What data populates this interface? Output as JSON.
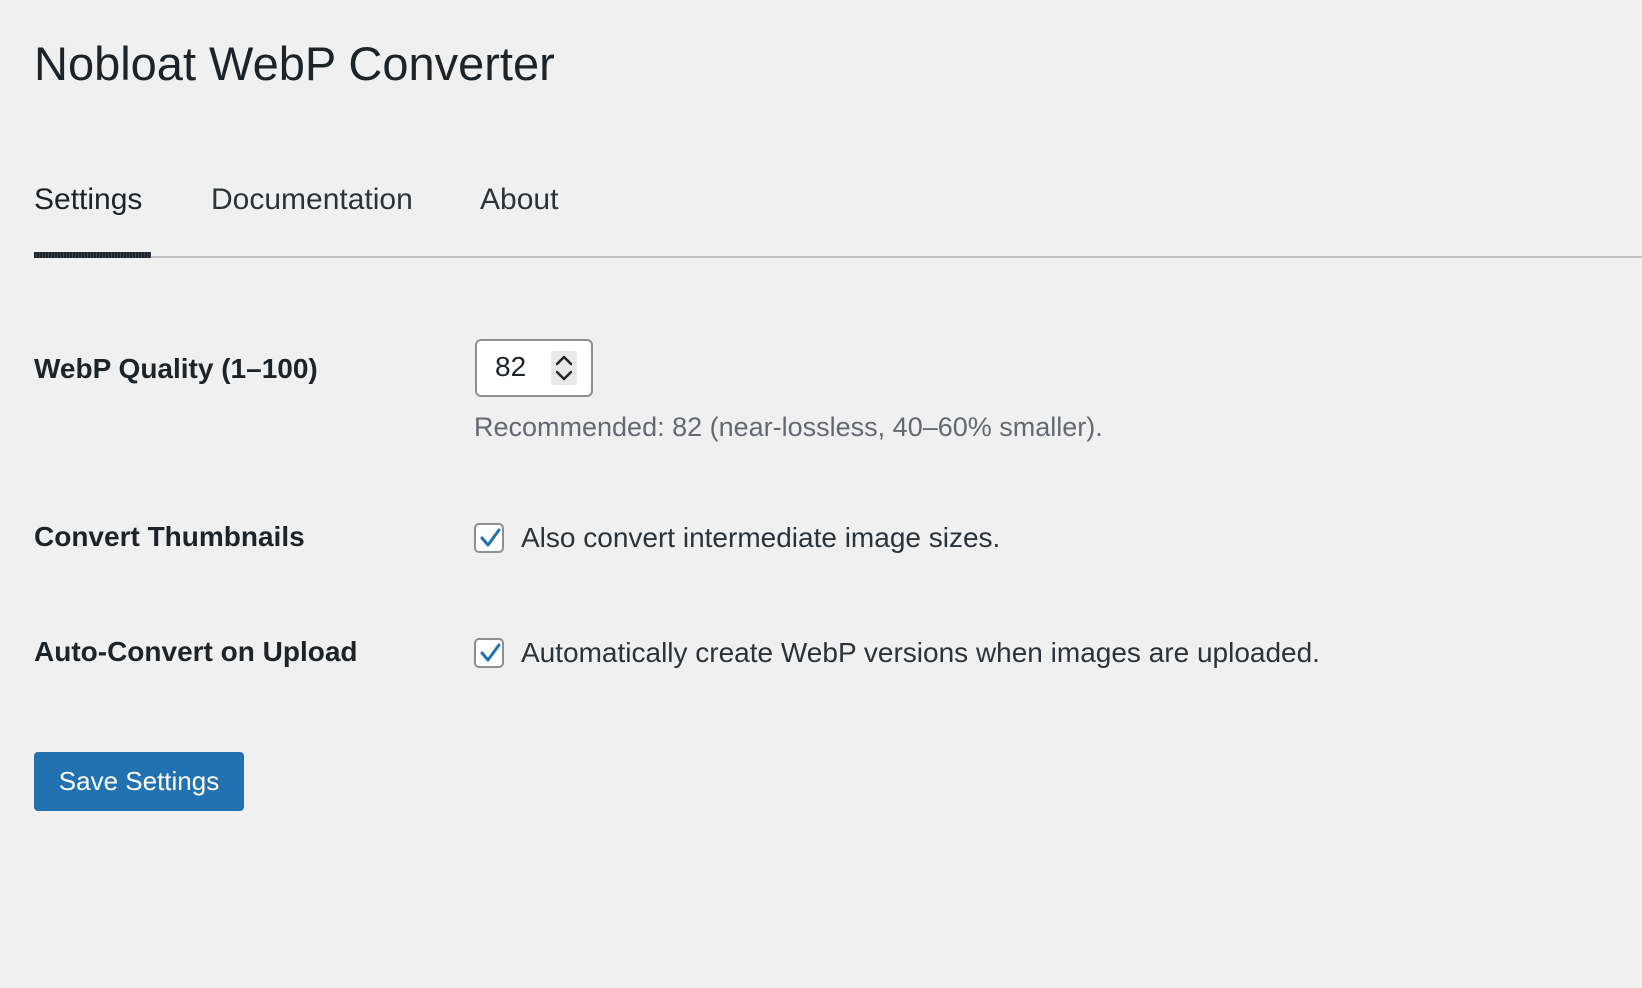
{
  "page": {
    "title": "Nobloat WebP Converter"
  },
  "tabs": [
    {
      "label": "Settings",
      "active": true
    },
    {
      "label": "Documentation",
      "active": false
    },
    {
      "label": "About",
      "active": false
    }
  ],
  "settings": {
    "quality": {
      "label": "WebP Quality (1–100)",
      "value": "82",
      "description": "Recommended: 82 (near-lossless, 40–60% smaller)."
    },
    "thumbnails": {
      "label": "Convert Thumbnails",
      "checked": true,
      "text": "Also convert intermediate image sizes."
    },
    "auto_convert": {
      "label": "Auto-Convert on Upload",
      "checked": true,
      "text": "Automatically create WebP versions when images are uploaded."
    }
  },
  "actions": {
    "save_label": "Save Settings"
  },
  "icons": {
    "spinner": "chevron-up-down-icon",
    "check": "checkmark-icon"
  },
  "colors": {
    "background": "#f0f0f1",
    "primary_button": "#2271b1",
    "checkmark": "#2271b1",
    "text": "#1d2327",
    "description": "#646970"
  }
}
